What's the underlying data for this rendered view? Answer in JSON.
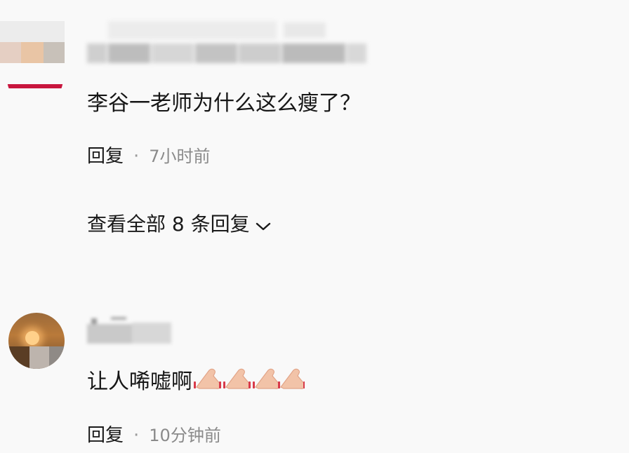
{
  "comments": [
    {
      "text": "李谷一老师为什么这么瘦了？",
      "reply_label": "回复",
      "separator": "·",
      "time": "7小时前",
      "view_replies": "查看全部 8 条回复"
    },
    {
      "text": "让人唏嘘啊",
      "emoji": "clapping-hands-icon",
      "reply_label": "回复",
      "separator": "·",
      "time": "10分钟前"
    }
  ],
  "colors": {
    "background": "#f9f9f9",
    "text": "#1a1a1a",
    "muted": "#8a8a8a",
    "avatar_red": "#c8163e"
  }
}
